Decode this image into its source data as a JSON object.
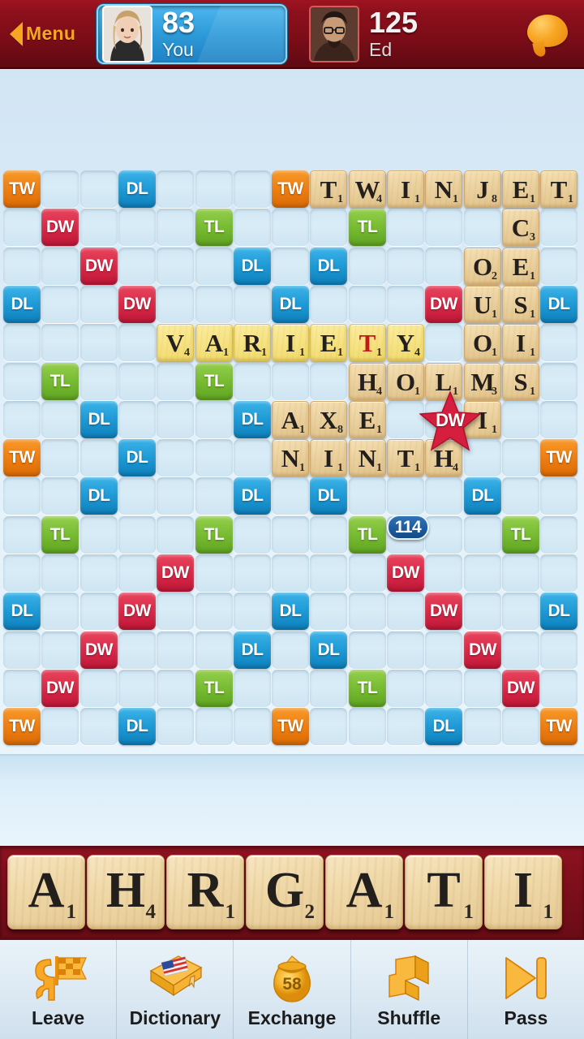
{
  "header": {
    "menu_label": "Menu",
    "menu_icon": "chevron-left-icon",
    "chat_icon": "chat-bubble-icon",
    "players": [
      {
        "score": "83",
        "name": "You",
        "avatar_icon": "avatar-you",
        "active": true
      },
      {
        "score": "125",
        "name": "Ed",
        "avatar_icon": "avatar-ed",
        "active": false
      }
    ]
  },
  "board": {
    "rows": 15,
    "cols": 15,
    "cell_size": 47.3,
    "bonus_labels": {
      "TW": "TW",
      "DW": "DW",
      "TL": "TL",
      "DL": "DL"
    },
    "colors": {
      "triple_word": "#ef7f12",
      "double_word": "#d92a48",
      "triple_letter": "#77bc32",
      "double_letter": "#1e9ad6",
      "empty_cell": "#d3e8f4",
      "tile": "#ecd3a1",
      "fresh_tile": "#f7e487"
    },
    "bonuses": [
      {
        "r": 0,
        "c": 0,
        "t": "TW"
      },
      {
        "r": 0,
        "c": 3,
        "t": "DL"
      },
      {
        "r": 0,
        "c": 7,
        "t": "TW"
      },
      {
        "r": 1,
        "c": 1,
        "t": "DW"
      },
      {
        "r": 1,
        "c": 5,
        "t": "TL"
      },
      {
        "r": 1,
        "c": 9,
        "t": "TL"
      },
      {
        "r": 2,
        "c": 2,
        "t": "DW"
      },
      {
        "r": 2,
        "c": 6,
        "t": "DL"
      },
      {
        "r": 2,
        "c": 8,
        "t": "DL"
      },
      {
        "r": 3,
        "c": 0,
        "t": "DL"
      },
      {
        "r": 3,
        "c": 3,
        "t": "DW"
      },
      {
        "r": 3,
        "c": 7,
        "t": "DL"
      },
      {
        "r": 3,
        "c": 11,
        "t": "DW"
      },
      {
        "r": 3,
        "c": 14,
        "t": "DL"
      },
      {
        "r": 5,
        "c": 1,
        "t": "TL"
      },
      {
        "r": 5,
        "c": 5,
        "t": "TL"
      },
      {
        "r": 6,
        "c": 2,
        "t": "DL"
      },
      {
        "r": 6,
        "c": 6,
        "t": "DL"
      },
      {
        "r": 7,
        "c": 0,
        "t": "TW"
      },
      {
        "r": 7,
        "c": 3,
        "t": "DL"
      },
      {
        "r": 7,
        "c": 7,
        "t": "DW"
      },
      {
        "r": 7,
        "c": 11,
        "t": "DL"
      },
      {
        "r": 7,
        "c": 14,
        "t": "TW"
      },
      {
        "r": 8,
        "c": 2,
        "t": "DL"
      },
      {
        "r": 8,
        "c": 6,
        "t": "DL"
      },
      {
        "r": 8,
        "c": 8,
        "t": "DL"
      },
      {
        "r": 8,
        "c": 12,
        "t": "DL"
      },
      {
        "r": 9,
        "c": 1,
        "t": "TL"
      },
      {
        "r": 9,
        "c": 5,
        "t": "TL"
      },
      {
        "r": 9,
        "c": 9,
        "t": "TL"
      },
      {
        "r": 9,
        "c": 13,
        "t": "TL"
      },
      {
        "r": 10,
        "c": 4,
        "t": "DW"
      },
      {
        "r": 10,
        "c": 10,
        "t": "DW"
      },
      {
        "r": 11,
        "c": 0,
        "t": "DL"
      },
      {
        "r": 11,
        "c": 3,
        "t": "DW"
      },
      {
        "r": 11,
        "c": 7,
        "t": "DL"
      },
      {
        "r": 11,
        "c": 11,
        "t": "DW"
      },
      {
        "r": 11,
        "c": 14,
        "t": "DL"
      },
      {
        "r": 12,
        "c": 2,
        "t": "DW"
      },
      {
        "r": 12,
        "c": 6,
        "t": "DL"
      },
      {
        "r": 12,
        "c": 8,
        "t": "DL"
      },
      {
        "r": 12,
        "c": 12,
        "t": "DW"
      },
      {
        "r": 13,
        "c": 1,
        "t": "DW"
      },
      {
        "r": 13,
        "c": 5,
        "t": "TL"
      },
      {
        "r": 13,
        "c": 9,
        "t": "TL"
      },
      {
        "r": 13,
        "c": 13,
        "t": "DW"
      },
      {
        "r": 14,
        "c": 0,
        "t": "TW"
      },
      {
        "r": 14,
        "c": 3,
        "t": "DL"
      },
      {
        "r": 14,
        "c": 7,
        "t": "TW"
      },
      {
        "r": 14,
        "c": 11,
        "t": "DL"
      },
      {
        "r": 14,
        "c": 14,
        "t": "TW"
      }
    ],
    "tiles": [
      {
        "r": 0,
        "c": 8,
        "l": "T",
        "v": "1"
      },
      {
        "r": 0,
        "c": 9,
        "l": "W",
        "v": "4"
      },
      {
        "r": 0,
        "c": 10,
        "l": "I",
        "v": "1"
      },
      {
        "r": 0,
        "c": 11,
        "l": "N",
        "v": "1"
      },
      {
        "r": 0,
        "c": 12,
        "l": "J",
        "v": "8"
      },
      {
        "r": 0,
        "c": 13,
        "l": "E",
        "v": "1"
      },
      {
        "r": 0,
        "c": 14,
        "l": "T",
        "v": "1"
      },
      {
        "r": 1,
        "c": 13,
        "l": "C",
        "v": "3"
      },
      {
        "r": 2,
        "c": 12,
        "l": "O",
        "v": "2"
      },
      {
        "r": 2,
        "c": 13,
        "l": "E",
        "v": "1"
      },
      {
        "r": 3,
        "c": 12,
        "l": "U",
        "v": "1"
      },
      {
        "r": 3,
        "c": 13,
        "l": "S",
        "v": "1"
      },
      {
        "r": 4,
        "c": 4,
        "l": "V",
        "v": "4",
        "fresh": true
      },
      {
        "r": 4,
        "c": 5,
        "l": "A",
        "v": "1",
        "fresh": true
      },
      {
        "r": 4,
        "c": 6,
        "l": "R",
        "v": "1",
        "fresh": true
      },
      {
        "r": 4,
        "c": 7,
        "l": "I",
        "v": "1",
        "fresh": true
      },
      {
        "r": 4,
        "c": 8,
        "l": "E",
        "v": "1",
        "fresh": true
      },
      {
        "r": 4,
        "c": 9,
        "l": "T",
        "v": "1",
        "fresh": true,
        "red": true
      },
      {
        "r": 4,
        "c": 10,
        "l": "Y",
        "v": "4",
        "fresh": true
      },
      {
        "r": 4,
        "c": 12,
        "l": "O",
        "v": "1"
      },
      {
        "r": 4,
        "c": 13,
        "l": "I",
        "v": "1"
      },
      {
        "r": 5,
        "c": 9,
        "l": "H",
        "v": "4"
      },
      {
        "r": 5,
        "c": 10,
        "l": "O",
        "v": "1"
      },
      {
        "r": 5,
        "c": 11,
        "l": "L",
        "v": "1"
      },
      {
        "r": 5,
        "c": 12,
        "l": "M",
        "v": "3"
      },
      {
        "r": 5,
        "c": 13,
        "l": "S",
        "v": "1"
      },
      {
        "r": 6,
        "c": 7,
        "l": "A",
        "v": "1"
      },
      {
        "r": 6,
        "c": 8,
        "l": "X",
        "v": "8"
      },
      {
        "r": 6,
        "c": 9,
        "l": "E",
        "v": "1"
      },
      {
        "r": 6,
        "c": 12,
        "l": "I",
        "v": "1"
      },
      {
        "r": 7,
        "c": 7,
        "l": "N",
        "v": "1"
      },
      {
        "r": 7,
        "c": 8,
        "l": "I",
        "v": "1"
      },
      {
        "r": 7,
        "c": 9,
        "l": "N",
        "v": "1"
      },
      {
        "r": 7,
        "c": 10,
        "l": "T",
        "v": "1"
      },
      {
        "r": 7,
        "c": 11,
        "l": "H",
        "v": "4"
      }
    ],
    "center_star": {
      "label": "DW",
      "r": 7,
      "c": 11,
      "icon": "star-icon"
    },
    "last_move_score": "114"
  },
  "rack": {
    "tiles": [
      {
        "letter": "A",
        "value": "1"
      },
      {
        "letter": "H",
        "value": "4"
      },
      {
        "letter": "R",
        "value": "1"
      },
      {
        "letter": "G",
        "value": "2"
      },
      {
        "letter": "A",
        "value": "1"
      },
      {
        "letter": "T",
        "value": "1"
      },
      {
        "letter": "I",
        "value": "1"
      }
    ]
  },
  "toolbar": {
    "buttons": [
      {
        "label": "Leave",
        "icon": "flag-person-icon"
      },
      {
        "label": "Dictionary",
        "icon": "book-flag-icon"
      },
      {
        "label": "Exchange",
        "icon": "tile-bag-icon",
        "badge": "58"
      },
      {
        "label": "Shuffle",
        "icon": "shuffle-arrows-icon"
      },
      {
        "label": "Pass",
        "icon": "skip-forward-icon"
      }
    ]
  }
}
